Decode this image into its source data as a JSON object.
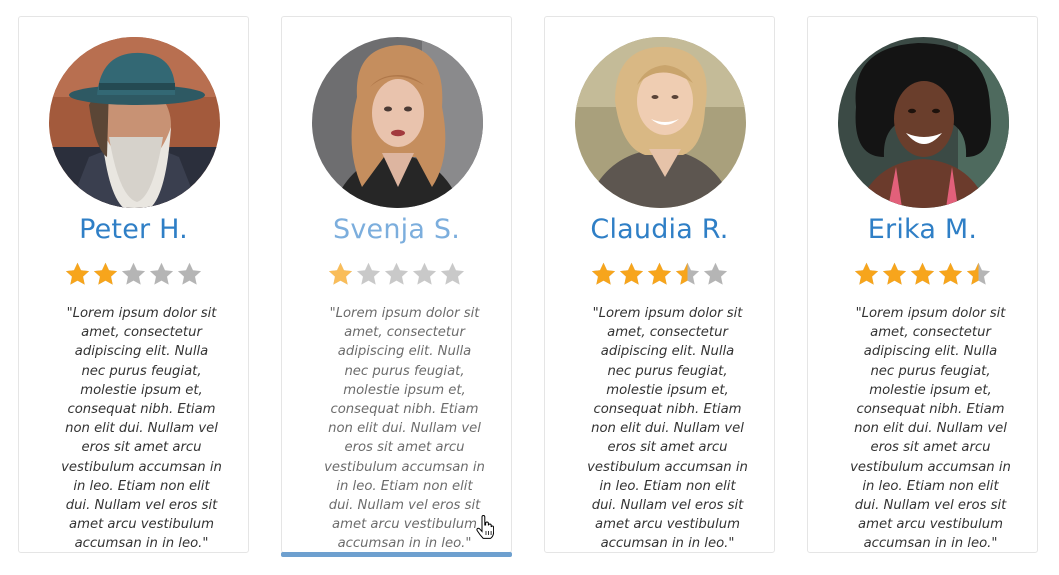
{
  "colors": {
    "accent": "#2f7fc6",
    "star_filled": "#f7a51c",
    "star_empty": "#b5b5b5",
    "active_bar": "#6ea0cf"
  },
  "testimonials": [
    {
      "name": "Peter H.",
      "rating": 2,
      "avatar": "old-man-with-hat-photo",
      "quote": "\"Lorem ipsum dolor sit amet, consectetur adipiscing elit. Nulla nec purus feugiat, molestie ipsum et, consequat nibh. Etiam non elit dui. Nullam vel eros sit amet arcu vestibulum accumsan in in leo. Etiam non elit dui. Nullam vel eros sit amet arcu vestibulum accumsan in in leo.\""
    },
    {
      "name": "Svenja S.",
      "rating": 1,
      "avatar": "red-haired-woman-photo",
      "quote": "\"Lorem ipsum dolor sit amet, consectetur adipiscing elit. Nulla nec purus feugiat, molestie ipsum et, consequat nibh. Etiam non elit dui. Nullam vel eros sit amet arcu vestibulum accumsan in in leo. Etiam non elit dui. Nullam vel eros sit amet arcu vestibulum accumsan in in leo.\""
    },
    {
      "name": "Claudia R.",
      "rating": 3.5,
      "avatar": "blonde-woman-photo",
      "quote": "\"Lorem ipsum dolor sit amet, consectetur adipiscing elit. Nulla nec purus feugiat, molestie ipsum et, consequat nibh. Etiam non elit dui. Nullam vel eros sit amet arcu vestibulum accumsan in in leo. Etiam non elit dui. Nullam vel eros sit amet arcu vestibulum accumsan in in leo.\""
    },
    {
      "name": "Erika M.",
      "rating": 4.5,
      "avatar": "curly-haired-woman-photo",
      "quote": "\"Lorem ipsum dolor sit amet, consectetur adipiscing elit. Nulla nec purus feugiat, molestie ipsum et, consequat nibh. Etiam non elit dui. Nullam vel eros sit amet arcu vestibulum accumsan in in leo. Etiam non elit dui. Nullam vel eros sit amet arcu vestibulum accumsan in in leo.\""
    }
  ],
  "active_card": 1,
  "cursor_icon": "hand-pointer-icon"
}
